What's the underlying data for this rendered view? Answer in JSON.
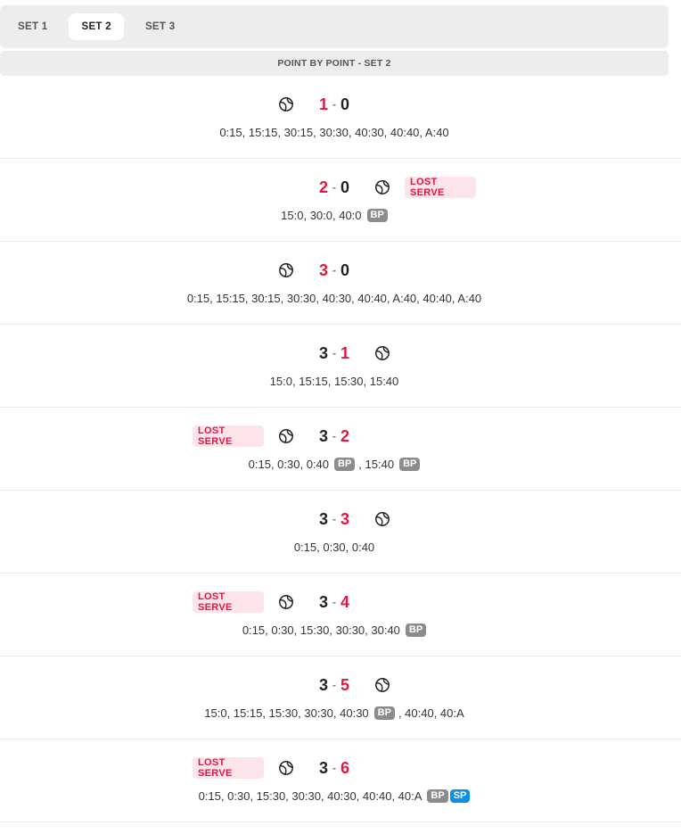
{
  "tabs": [
    {
      "label": "SET 1",
      "active": false
    },
    {
      "label": "SET 2",
      "active": true
    },
    {
      "label": "SET 3",
      "active": false
    }
  ],
  "section_title": "POINT BY POINT - SET 2",
  "lost_serve_label": "LOST SERVE",
  "games": [
    {
      "left": "1",
      "right": "0",
      "leader": "left",
      "server": "left",
      "lost_serve": null,
      "points": [
        {
          "t": "0:15, 15:15, 30:15, 30:30, 40:30, 40:40, A:40"
        }
      ]
    },
    {
      "left": "2",
      "right": "0",
      "leader": "left",
      "server": "right",
      "lost_serve": "right",
      "points": [
        {
          "t": "15:0, 30:0, 40:0"
        },
        {
          "b": "BP"
        }
      ]
    },
    {
      "left": "3",
      "right": "0",
      "leader": "left",
      "server": "left",
      "lost_serve": null,
      "points": [
        {
          "t": "0:15, 15:15, 30:15, 30:30, 40:30, 40:40, A:40, 40:40, A:40"
        }
      ]
    },
    {
      "left": "3",
      "right": "1",
      "leader": "right",
      "server": "right",
      "lost_serve": null,
      "points": [
        {
          "t": "15:0, 15:15, 15:30, 15:40"
        }
      ]
    },
    {
      "left": "3",
      "right": "2",
      "leader": "right",
      "server": "left",
      "lost_serve": "left",
      "points": [
        {
          "t": "0:15, 0:30, 0:40"
        },
        {
          "b": "BP"
        },
        {
          "t": ", 15:40"
        },
        {
          "b": "BP"
        }
      ]
    },
    {
      "left": "3",
      "right": "3",
      "leader": "right",
      "server": "right",
      "lost_serve": null,
      "points": [
        {
          "t": "0:15, 0:30, 0:40"
        }
      ]
    },
    {
      "left": "3",
      "right": "4",
      "leader": "right",
      "server": "left",
      "lost_serve": "left",
      "points": [
        {
          "t": "0:15, 0:30, 15:30, 30:30, 30:40"
        },
        {
          "b": "BP"
        }
      ]
    },
    {
      "left": "3",
      "right": "5",
      "leader": "right",
      "server": "right",
      "lost_serve": null,
      "points": [
        {
          "t": "15:0, 15:15, 15:30, 30:30, 40:30"
        },
        {
          "b": "BP"
        },
        {
          "t": ", 40:40, 40:A"
        }
      ]
    },
    {
      "left": "3",
      "right": "6",
      "leader": "right",
      "server": "left",
      "lost_serve": "left",
      "points": [
        {
          "t": "0:15, 0:30, 15:30, 30:30, 40:30, 40:40, 40:A"
        },
        {
          "b": "BP"
        },
        {
          "b": "SP",
          "kind": "sp"
        }
      ]
    }
  ],
  "colors": {
    "accent_red": "#e3163f",
    "badge_gray": "#8c8c8c",
    "badge_blue": "#0b8fe8",
    "lost_serve_bg": "#fde4ea"
  },
  "icons": {
    "server": "tennis-ball-icon"
  }
}
